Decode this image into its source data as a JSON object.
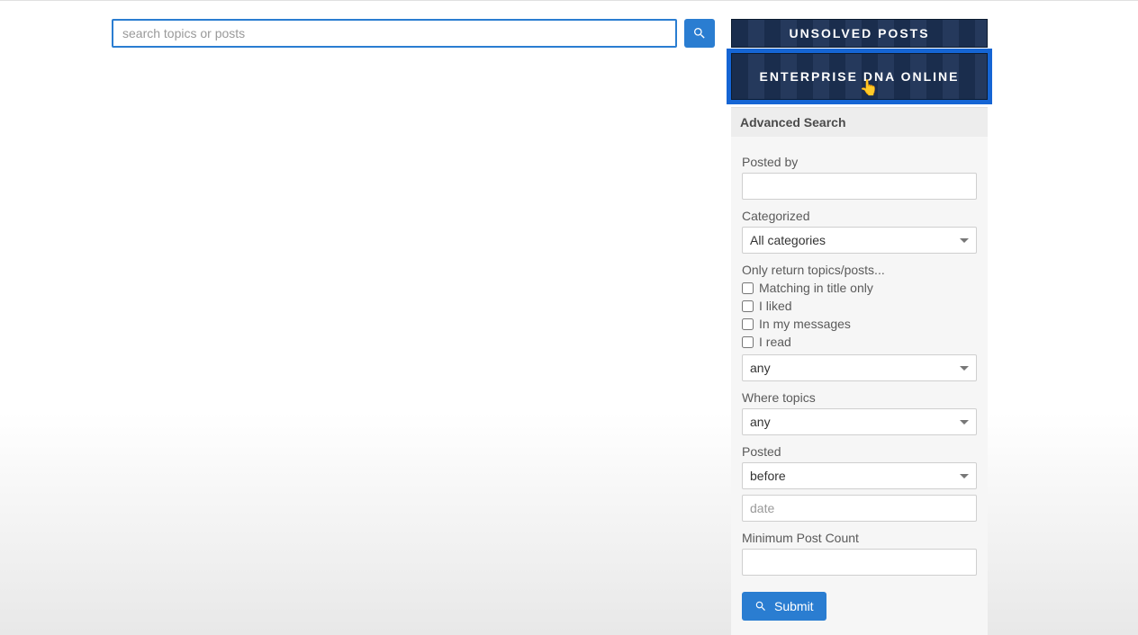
{
  "search": {
    "placeholder": "search topics or posts"
  },
  "banners": {
    "unsolved": "UNSOLVED POSTS",
    "online": "ENTERPRISE DNA ONLINE"
  },
  "advanced": {
    "title": "Advanced Search",
    "posted_by_label": "Posted by",
    "categorized_label": "Categorized",
    "categorized_value": "All categories",
    "filter_header": "Only return topics/posts...",
    "checks": {
      "title_only": "Matching in title only",
      "liked": "I liked",
      "messages": "In my messages",
      "read": "I read"
    },
    "filter_select": "any",
    "where_label": "Where topics",
    "where_value": "any",
    "posted_label": "Posted",
    "posted_value": "before",
    "date_placeholder": "date",
    "min_count_label": "Minimum Post Count",
    "submit_label": "Submit"
  }
}
